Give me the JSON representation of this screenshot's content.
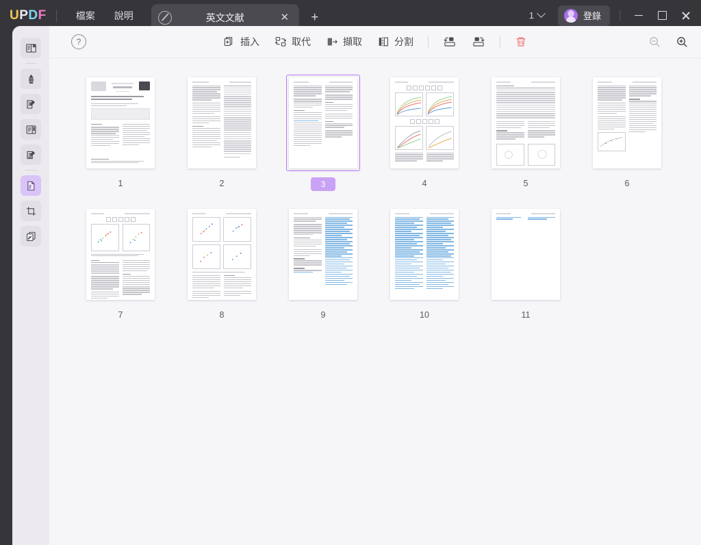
{
  "app": {
    "logo_letters": [
      "U",
      "P",
      "D",
      "F"
    ],
    "menu": [
      {
        "label": "檔案",
        "name": "menu-file"
      },
      {
        "label": "說明",
        "name": "menu-help"
      }
    ]
  },
  "tab": {
    "title": "英文文献",
    "icon": "no-annotation-circle-slash-icon",
    "close_label": "✕",
    "add_label": "+"
  },
  "titlebar_right": {
    "page_count": "1",
    "page_count_chevron": "chevron-down-icon",
    "sign_in_label": "登錄",
    "minimize": "−",
    "maximize": "□",
    "close": "✕"
  },
  "sidebar": {
    "items": [
      {
        "name": "sidebar-item-reader",
        "icon": "book-reader-icon",
        "active": false
      },
      {
        "name": "sidebar-item-annotate",
        "icon": "highlighter-pen-icon",
        "active": false
      },
      {
        "name": "sidebar-item-edit",
        "icon": "edit-document-icon",
        "active": false
      },
      {
        "name": "sidebar-item-form",
        "icon": "form-fields-icon",
        "active": false
      },
      {
        "name": "sidebar-item-comment",
        "icon": "comment-edit-icon",
        "active": false
      },
      {
        "name": "sidebar-item-organize-pages",
        "icon": "page-organize-icon",
        "active": true
      },
      {
        "name": "sidebar-item-crop",
        "icon": "crop-icon",
        "active": false
      },
      {
        "name": "sidebar-item-convert",
        "icon": "convert-pages-icon",
        "active": false
      }
    ]
  },
  "toolbar": {
    "help_label": "?",
    "buttons": [
      {
        "label": "插入",
        "name": "insert-pages-button",
        "icon": "page-plus-icon"
      },
      {
        "label": "取代",
        "name": "replace-pages-button",
        "icon": "replace-pages-icon"
      },
      {
        "label": "擷取",
        "name": "extract-pages-button",
        "icon": "extract-pages-icon"
      },
      {
        "label": "分割",
        "name": "split-pages-button",
        "icon": "split-pages-icon"
      }
    ],
    "rotate_left": {
      "name": "rotate-left-button",
      "icon": "rotate-left-icon"
    },
    "rotate_right": {
      "name": "rotate-right-button",
      "icon": "rotate-right-icon"
    },
    "delete": {
      "name": "delete-pages-button",
      "icon": "trash-icon"
    },
    "zoom_out": {
      "name": "zoom-out-button",
      "icon": "zoom-out-icon",
      "enabled": false
    },
    "zoom_in": {
      "name": "zoom-in-button",
      "icon": "zoom-in-icon",
      "enabled": true
    }
  },
  "thumbnails": {
    "selected_page": "3",
    "pages": [
      {
        "number": "1",
        "kind": "cover"
      },
      {
        "number": "2",
        "kind": "text-table"
      },
      {
        "number": "3",
        "kind": "text-two-col"
      },
      {
        "number": "4",
        "kind": "charts-line"
      },
      {
        "number": "5",
        "kind": "table-and-plots"
      },
      {
        "number": "6",
        "kind": "text-small-plot"
      },
      {
        "number": "7",
        "kind": "scatter-and-table"
      },
      {
        "number": "8",
        "kind": "scatter-grid"
      },
      {
        "number": "9",
        "kind": "references-start"
      },
      {
        "number": "10",
        "kind": "references"
      },
      {
        "number": "11",
        "kind": "near-empty"
      }
    ]
  },
  "colors": {
    "accent_purple": "#a163e8",
    "selection_border": "#b07ef0",
    "badge_bg": "#c9a2f5",
    "danger_red": "#ef6b6b",
    "titlebar_bg": "#35353a",
    "sidebar_bg": "#eceaef",
    "content_bg": "#f6f5f8"
  }
}
